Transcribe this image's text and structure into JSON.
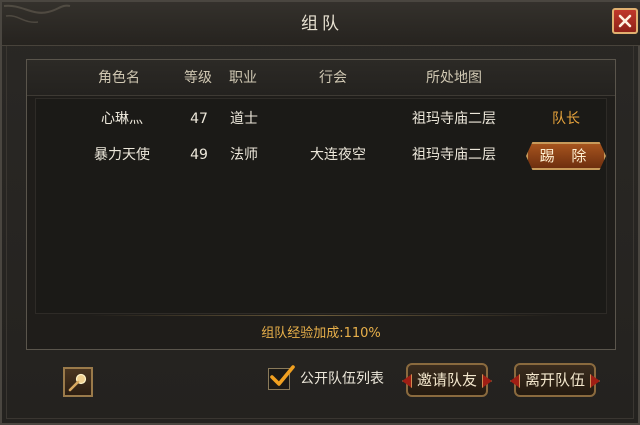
{
  "window": {
    "title": "组队"
  },
  "columns": [
    "角色名",
    "等级",
    "职业",
    "行会",
    "所处地图"
  ],
  "members": [
    {
      "name": "心琳灬",
      "level": "47",
      "class": "道士",
      "guild": "",
      "map": "祖玛寺庙二层",
      "action": "队长"
    },
    {
      "name": "暴力天使",
      "level": "49",
      "class": "法师",
      "guild": "大连夜空",
      "map": "祖玛寺庙二层",
      "action": "踢 除"
    }
  ],
  "bonus_text": "组队经验加成:110%",
  "footer": {
    "public_list_label": "公开队伍列表",
    "public_list_checked": true,
    "invite_label": "邀请队友",
    "leave_label": "离开队伍"
  },
  "icons": {
    "close": "close-icon",
    "tool": "magnifier-wand-icon",
    "check": "checkmark-icon"
  },
  "colors": {
    "leader_text": "#e8a43c",
    "bonus_text": "#e8b04a",
    "kick_button": "#a6541e",
    "close_button": "#c0392b"
  }
}
